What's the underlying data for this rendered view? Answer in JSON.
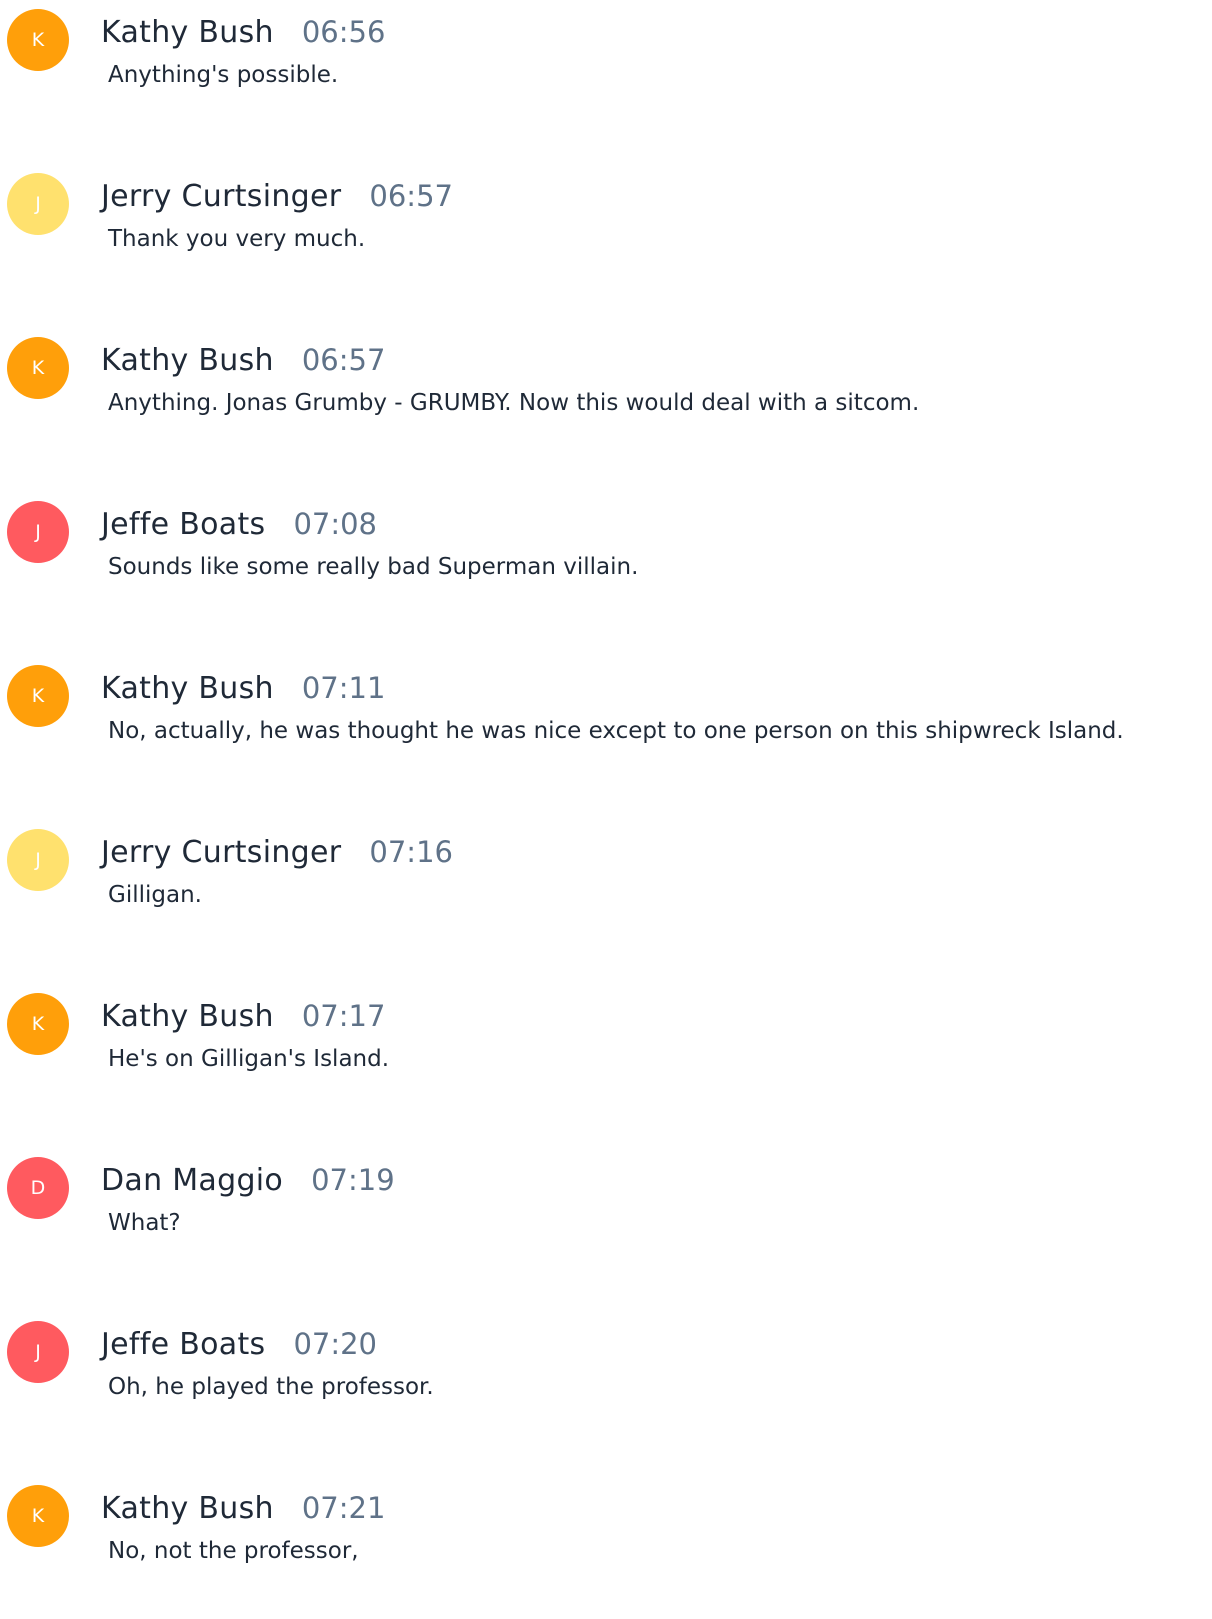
{
  "messages": [
    {
      "initial": "K",
      "name": "Kathy Bush",
      "time": "06:56",
      "text": "Anything's possible.",
      "avatar_color": "#FF9F0A"
    },
    {
      "initial": "J",
      "name": "Jerry Curtsinger",
      "time": "06:57",
      "text": "Thank you very much.",
      "avatar_color": "#FFE16E"
    },
    {
      "initial": "K",
      "name": "Kathy Bush",
      "time": "06:57",
      "text": "Anything. Jonas Grumby - GRUMBY. Now this would deal with a sitcom.",
      "avatar_color": "#FF9F0A"
    },
    {
      "initial": "J",
      "name": "Jeffe Boats",
      "time": "07:08",
      "text": "Sounds like some really bad Superman villain.",
      "avatar_color": "#FF5A5F"
    },
    {
      "initial": "K",
      "name": "Kathy Bush",
      "time": "07:11",
      "text": "No, actually, he was thought he was nice except to one person on this shipwreck Island.",
      "avatar_color": "#FF9F0A"
    },
    {
      "initial": "J",
      "name": "Jerry Curtsinger",
      "time": "07:16",
      "text": "Gilligan.",
      "avatar_color": "#FFE16E"
    },
    {
      "initial": "K",
      "name": "Kathy Bush",
      "time": "07:17",
      "text": "He's on Gilligan's Island.",
      "avatar_color": "#FF9F0A"
    },
    {
      "initial": "D",
      "name": "Dan Maggio",
      "time": "07:19",
      "text": "What?",
      "avatar_color": "#FF5A5F"
    },
    {
      "initial": "J",
      "name": "Jeffe Boats",
      "time": "07:20",
      "text": "Oh, he played the professor.",
      "avatar_color": "#FF5A5F"
    },
    {
      "initial": "K",
      "name": "Kathy Bush",
      "time": "07:21",
      "text": "No, not the professor,",
      "avatar_color": "#FF9F0A"
    }
  ]
}
